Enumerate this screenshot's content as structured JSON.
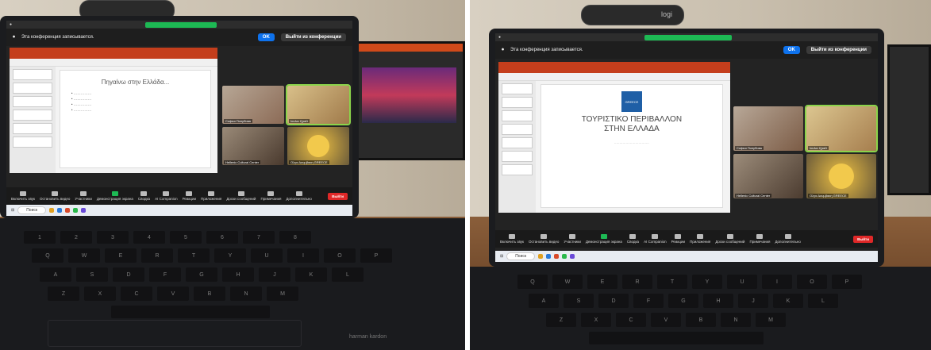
{
  "left_photo": {
    "recording_notice": "Эта конференция записывается.",
    "ok_label": "OK",
    "leave_label": "Выйти из конференции",
    "slide_title": "Πηγαίνω στην Ελλάδα...",
    "participants": [
      {
        "name": "Софья Попубова"
      },
      {
        "name": "Ιουλια Ιζραϊλ"
      },
      {
        "name": "Hellenic Cultural Center"
      },
      {
        "name": "Ολγα Δουμβακη GREECE"
      }
    ],
    "toolbar": [
      "Включить звук",
      "Остановить видео",
      "Участники",
      "Демонстрация экрана",
      "Сводка",
      "AI Companion",
      "Реакции",
      "Приложения",
      "Доски сообщений",
      "Примечания",
      "Дополнительно"
    ],
    "end_label": "Выйти",
    "taskbar_search": "Поиск",
    "keyboard_brand": "harman kardon"
  },
  "right_photo": {
    "webcam_brand": "logi",
    "recording_notice": "Эта конференция записывается.",
    "ok_label": "OK",
    "leave_label": "Выйти из конференции",
    "slide_logo": "GREECE",
    "slide_title_line1": "ΤΟΥΡΙΣΤΙΚΟ ΠΕΡΙΒΑΛΛΟΝ",
    "slide_title_line2": "ΣΤΗΝ ΕΛΛΑΔΑ",
    "participants": [
      {
        "name": "Софья Попубова"
      },
      {
        "name": "Ιουλια Ιζραϊλ"
      },
      {
        "name": "Hellenic Cultural Center"
      },
      {
        "name": "Ολγα Δουμβακη GREECE"
      }
    ],
    "toolbar": [
      "Включить звук",
      "Остановить видео",
      "Участники",
      "Демонстрация экрана",
      "Сводка",
      "AI Companion",
      "Реакции",
      "Приложения",
      "Доски сообщений",
      "Примечания",
      "Дополнительно"
    ],
    "end_label": "Выйти",
    "taskbar_search": "Поиск"
  },
  "colors": {
    "zoom_blue": "#0e72ed",
    "share_green": "#1db954",
    "end_red": "#e02828",
    "ppt_orange": "#c43e1c"
  }
}
